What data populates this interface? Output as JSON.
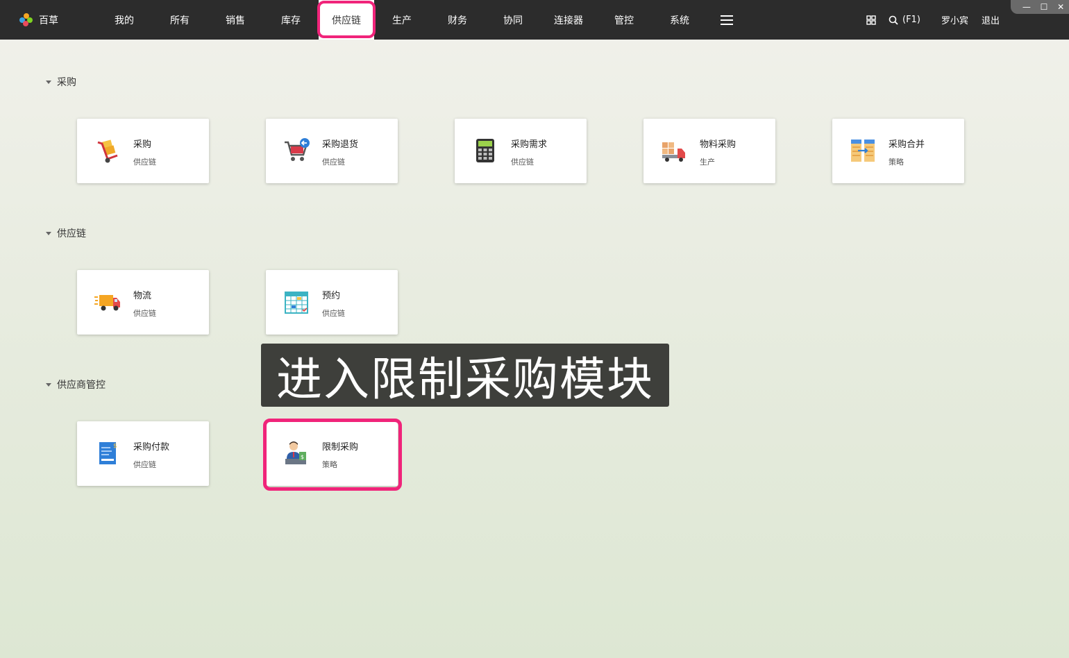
{
  "brand": {
    "name": "百草"
  },
  "nav": {
    "items": [
      "我的",
      "所有",
      "销售",
      "库存",
      "供应链",
      "生产",
      "财务",
      "协同",
      "连接器",
      "管控",
      "系统"
    ],
    "active": "供应链"
  },
  "toolbar": {
    "search_hint": "(F1)",
    "user": "罗小宾",
    "logout": "退出"
  },
  "sections": [
    {
      "title": "采购",
      "cards": [
        {
          "name": "采购",
          "module": "供应链",
          "icon": "hand-truck-icon"
        },
        {
          "name": "采购退货",
          "module": "供应链",
          "icon": "cart-return-icon"
        },
        {
          "name": "采购需求",
          "module": "供应链",
          "icon": "calculator-icon"
        },
        {
          "name": "物料采购",
          "module": "生产",
          "icon": "delivery-truck-icon"
        },
        {
          "name": "采购合并",
          "module": "策略",
          "icon": "merge-table-icon"
        }
      ]
    },
    {
      "title": "供应链",
      "cards": [
        {
          "name": "物流",
          "module": "供应链",
          "icon": "fast-truck-icon"
        },
        {
          "name": "预约",
          "module": "供应链",
          "icon": "calendar-icon"
        }
      ]
    },
    {
      "title": "供应商管控",
      "cards": [
        {
          "name": "采购付款",
          "module": "供应链",
          "icon": "payment-document-icon"
        },
        {
          "name": "限制采购",
          "module": "策略",
          "icon": "cashier-icon"
        }
      ]
    }
  ],
  "caption": "进入限制采购模块",
  "colors": {
    "highlight": "#f0247a",
    "topbar": "#2c2c2c"
  }
}
